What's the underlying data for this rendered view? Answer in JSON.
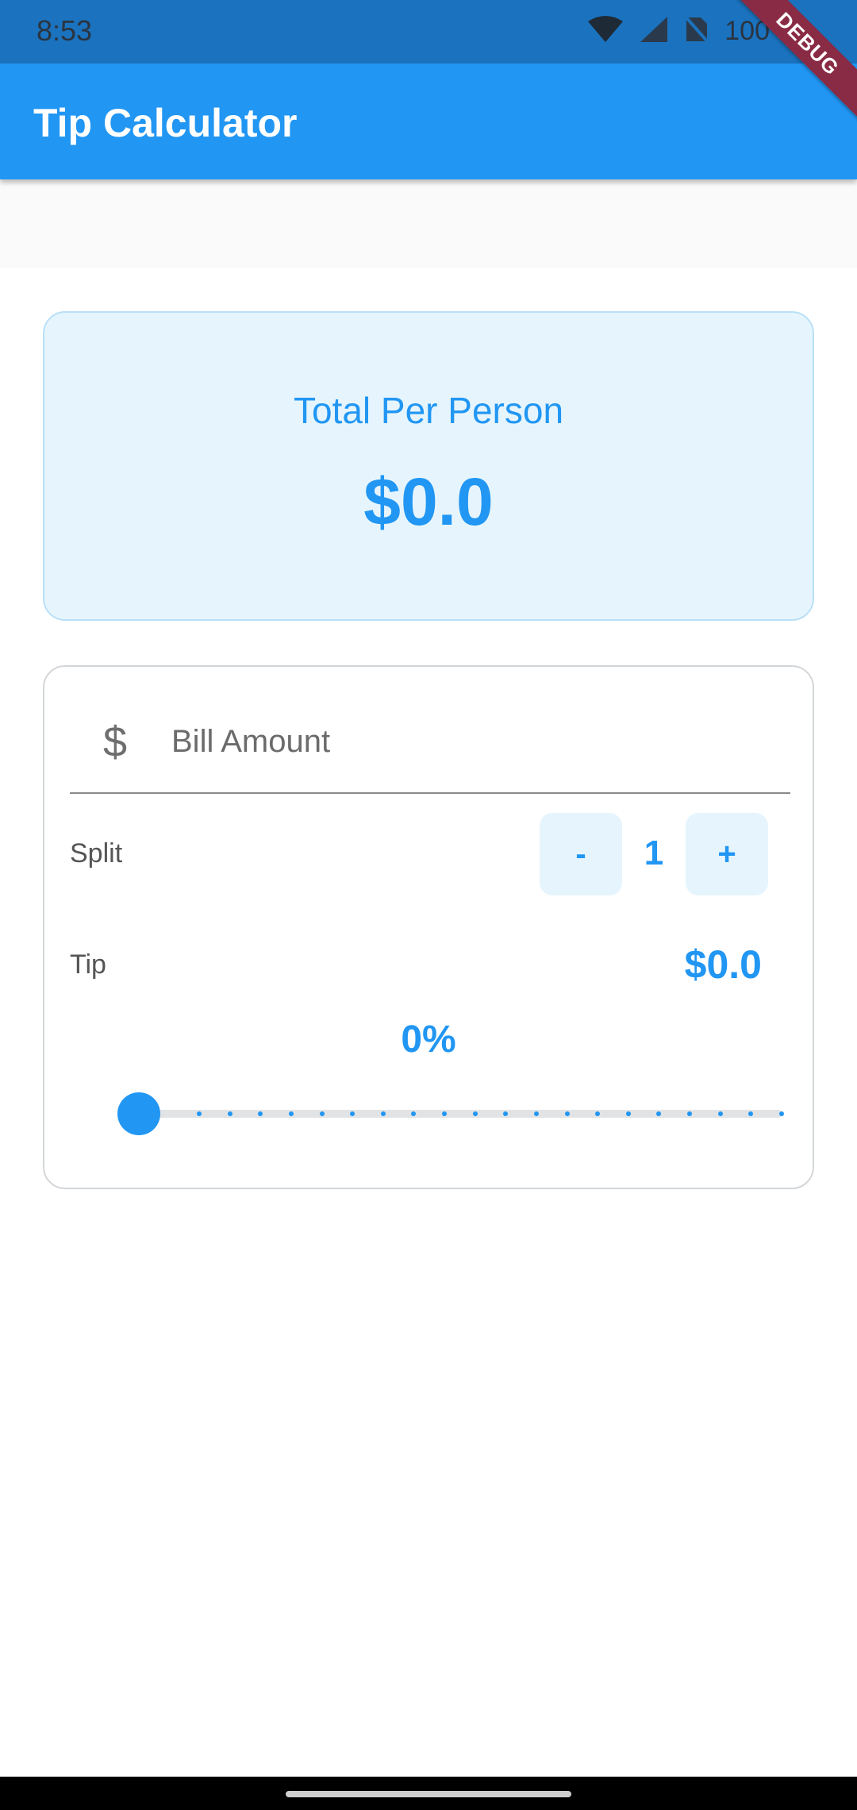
{
  "status_bar": {
    "time": "8:53",
    "battery_text": "100"
  },
  "debug_ribbon": "DEBUG",
  "app_bar": {
    "title": "Tip Calculator"
  },
  "summary": {
    "label": "Total Per Person",
    "amount": "$0.0"
  },
  "bill": {
    "prefix_icon": "dollar-icon",
    "prefix_glyph": "$",
    "placeholder": "Bill Amount",
    "value": ""
  },
  "split": {
    "label": "Split",
    "minus_label": "-",
    "count": "1",
    "plus_label": "+"
  },
  "tip": {
    "label": "Tip",
    "amount": "$0.0",
    "percent_text": "0%",
    "slider_value": 0
  },
  "colors": {
    "primary": "#2196f3",
    "card_bg": "#e6f5fd",
    "status_bar": "#1b73bf",
    "ribbon": "#8a2b45"
  }
}
